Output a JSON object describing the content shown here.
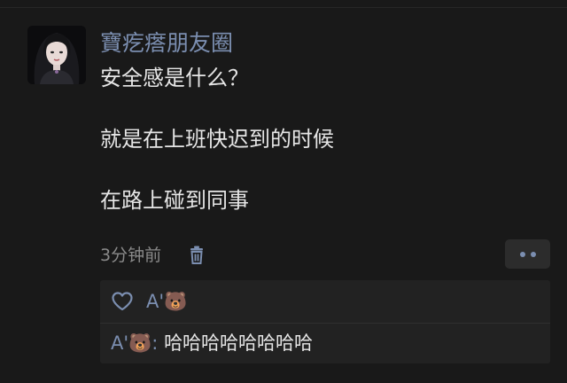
{
  "post": {
    "username": "寶疙瘩朋友圈",
    "lines": [
      "安全感是什么？",
      "就是在上班快迟到的时候",
      "在路上碰到同事"
    ],
    "time": "3分钟前"
  },
  "interactions": {
    "like_icon": "heart-outline-icon",
    "likes": [
      "A'🐻"
    ],
    "comments": [
      {
        "author": "A'🐻",
        "separator": ":",
        "text": "哈哈哈哈哈哈哈哈"
      }
    ]
  },
  "colors": {
    "background": "#191919",
    "name_link": "#7b8eb0",
    "text": "#e6e6e6",
    "muted": "#8a8a8a",
    "panel": "#222222"
  }
}
